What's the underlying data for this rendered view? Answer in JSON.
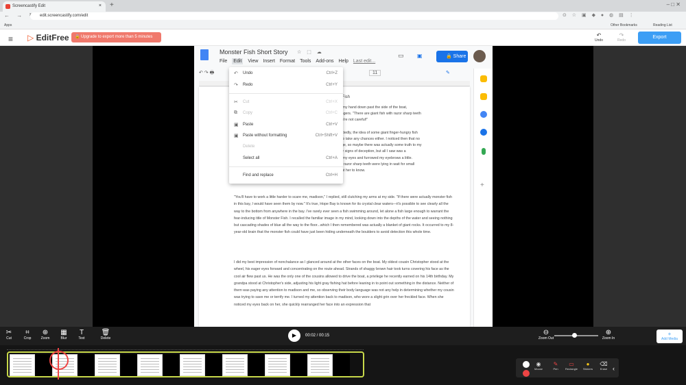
{
  "browser": {
    "tab_title": "Screencastify Edit",
    "tab_close": "×",
    "new_tab": "+",
    "window_controls": "–  □  ✕",
    "nav": "← → ↻",
    "url": "edit.screencastify.com/edit",
    "bookmarks": {
      "apps": "Apps",
      "other": "Other Bookmarks",
      "reading": "Reading List"
    }
  },
  "app": {
    "logo_text": "EditFree",
    "logo_mark": "▷",
    "menu_icon": "≡",
    "upgrade_label": "Upgrade to export more than 5 minutes",
    "lock_icon": "🔒",
    "undo_label": "Undo",
    "undo_icon": "↶",
    "redo_label": "Redo",
    "redo_icon": "↷",
    "export_label": "Export"
  },
  "docs": {
    "title": "Monster Fish Short Story",
    "title_icons": "☆ ⬚ ☁",
    "menu": [
      "File",
      "Edit",
      "View",
      "Insert",
      "Format",
      "Tools",
      "Add-ons",
      "Help"
    ],
    "last_edit": "Last edit...",
    "share_label": "Share",
    "share_icon": "🔒",
    "comment_icon": "▭",
    "meet_icon": "▣",
    "toolbar": "↶ ↷ 🖶",
    "font_size": "11",
    "heading_snippet": "r Fish",
    "right_fragment": "d my hand down past the side of the boat,\nfingers. \"There are giant fish with razor sharp teeth\nou're not careful!\"\n\nnittedly, the idea of some giant finger-hungry fish\nt to take any chances either. I noticed then that no\ndge, so maybe there was actually some truth to my\nfor signs of deception, but all I saw was a\nd my eyes and furrowed my eyebrows a little.\nth razor sharp teeth were lying in wait for small\nant her to know.",
    "para1": "\"You'll have to work a little harder to scare me, madison,\" I replied, still clutching my arms at my side. \"If there were actually monster fish in this bay, I would have seen them by now.\" It's true, Hope Bay is known for its crystal clear waters—it's possible to see clearly all the way to the bottom from anywhere in the bay. I've rarely ever seen a fish swimming around, let alone a fish large enough to warrant the fear-inducing title of Monster Fish. I recalled the familiar image in my mind, looking down into the depths of the water and seeing nothing but cascading shades of blue all the way to the floor...which I then remembered was actually a blanket of giant rocks. It occurred to my 8-year-old brain that the monster fish could have just been hiding underneath the boulders to avoid detection this whole time.",
    "para2": "I did my best impression of nonchalance as I glanced around at the other faces on the boat. My oldest cousin Christopher stood at the wheel, his eager eyes forward and concentrating on the route ahead. Strands of shaggy brown hair took turns covering his face as the cool air flew past us. He was the only one of the cousins allowed to drive the boat, a privilege he recently earned on his 14th birthday. My grandpa stood at Christopher's side, adjusting his light gray fishing hat before leaning in to point out something in the distance. Neither of them was paying any attention to madison and me, so observing their body language was not any help in determining whether my cousin was trying to save me or terrify me. I turned my attention back to madison, who wore a slight grin over her freckled face. When she noticed my eyes back on her, she quickly rearranged her face into an expression that"
  },
  "edit_menu": [
    {
      "label": "Undo",
      "shortcut": "Ctrl+Z",
      "icon": "↶",
      "disabled": false
    },
    {
      "label": "Redo",
      "shortcut": "Ctrl+Y",
      "icon": "↷",
      "disabled": false
    },
    {
      "label": "Cut",
      "shortcut": "Ctrl+X",
      "icon": "✂",
      "disabled": true
    },
    {
      "label": "Copy",
      "shortcut": "Ctrl+C",
      "icon": "⧉",
      "disabled": true
    },
    {
      "label": "Paste",
      "shortcut": "Ctrl+V",
      "icon": "▣",
      "disabled": false
    },
    {
      "label": "Paste without formatting",
      "shortcut": "Ctrl+Shift+V",
      "icon": "▣",
      "disabled": false
    },
    {
      "label": "Delete",
      "shortcut": "",
      "icon": "",
      "disabled": true
    },
    {
      "label": "Select all",
      "shortcut": "Ctrl+A",
      "icon": "",
      "disabled": false
    },
    {
      "label": "Find and replace",
      "shortcut": "Ctrl+H",
      "icon": "",
      "disabled": false
    }
  ],
  "editor_tools": [
    {
      "label": "Cut",
      "icon": "✂"
    },
    {
      "label": "Crop",
      "icon": "⌗"
    },
    {
      "label": "Zoom",
      "icon": "⊕"
    },
    {
      "label": "Blur",
      "icon": "▦"
    },
    {
      "label": "Text",
      "icon": "T"
    },
    {
      "label": "Delete",
      "icon": "🗑"
    }
  ],
  "playback": {
    "play_icon": "▶",
    "time": "00:02 / 00:15"
  },
  "zoom": {
    "out_label": "Zoom Out",
    "in_label": "Zoom In",
    "out_icon": "⊖",
    "in_icon": "⊕",
    "level": 0.45
  },
  "add_media": {
    "label": "Add Media",
    "icon": "+"
  },
  "annotation_tools": [
    {
      "label": "Mouse",
      "icon": "◉"
    },
    {
      "label": "Pen",
      "icon": "✎"
    },
    {
      "label": "Rectangle",
      "icon": "▭"
    },
    {
      "label": "Stickers",
      "icon": "●"
    },
    {
      "label": "Erase",
      "icon": "⌫"
    }
  ],
  "colors": {
    "accent": "#3c9ef5",
    "upgrade": "#f0796c",
    "timeline_border": "#c8d94a",
    "playhead": "#e44444",
    "docs_blue": "#1a73e8"
  }
}
